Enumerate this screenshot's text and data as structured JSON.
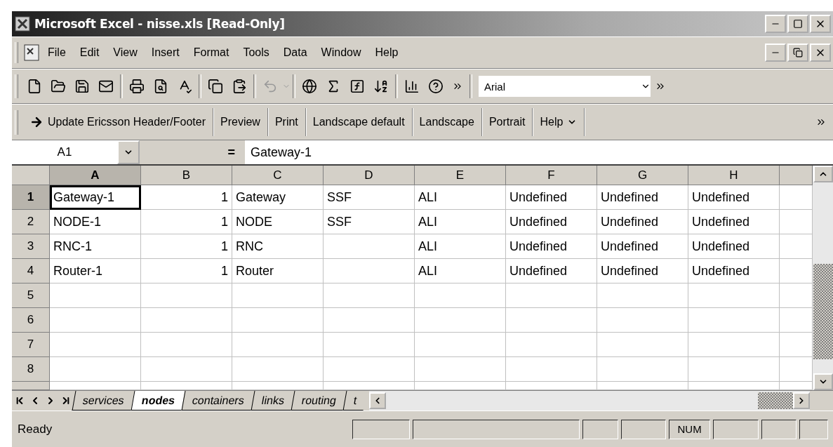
{
  "window": {
    "title": "Microsoft Excel - nisse.xls  [Read-Only]"
  },
  "menu": [
    "File",
    "Edit",
    "View",
    "Insert",
    "Format",
    "Tools",
    "Data",
    "Window",
    "Help"
  ],
  "font_box": {
    "value": "Arial"
  },
  "custom_toolbar": [
    {
      "label": "Update Ericsson Header/Footer",
      "kind": "arrow"
    },
    {
      "label": "Preview",
      "kind": "plain"
    },
    {
      "label": "Print",
      "kind": "plain"
    },
    {
      "label": "Landscape default",
      "kind": "plain"
    },
    {
      "label": "Landscape",
      "kind": "plain"
    },
    {
      "label": "Portrait",
      "kind": "plain"
    },
    {
      "label": "Help",
      "kind": "dropdown"
    }
  ],
  "formula_bar": {
    "name_box": "A1",
    "equals": "=",
    "value": "Gateway-1"
  },
  "table": {
    "columns": [
      {
        "label": "A",
        "selected": true
      },
      {
        "label": "B",
        "selected": false
      },
      {
        "label": "C",
        "selected": false
      },
      {
        "label": "D",
        "selected": false
      },
      {
        "label": "E",
        "selected": false
      },
      {
        "label": "F",
        "selected": false
      },
      {
        "label": "G",
        "selected": false
      },
      {
        "label": "H",
        "selected": false
      }
    ],
    "rows": [
      {
        "label": "1",
        "selected": true,
        "cells": [
          "Gateway-1",
          "1",
          "Gateway",
          "SSF",
          "ALI",
          "Undefined",
          "Undefined",
          "Undefined"
        ]
      },
      {
        "label": "2",
        "selected": false,
        "cells": [
          "NODE-1",
          "1",
          "NODE",
          "SSF",
          "ALI",
          "Undefined",
          "Undefined",
          "Undefined"
        ]
      },
      {
        "label": "3",
        "selected": false,
        "cells": [
          "RNC-1",
          "1",
          "RNC",
          "",
          "ALI",
          "Undefined",
          "Undefined",
          "Undefined"
        ]
      },
      {
        "label": "4",
        "selected": false,
        "cells": [
          "Router-1",
          "1",
          "Router",
          "",
          "ALI",
          "Undefined",
          "Undefined",
          "Undefined"
        ]
      },
      {
        "label": "5",
        "selected": false,
        "cells": []
      },
      {
        "label": "6",
        "selected": false,
        "cells": []
      },
      {
        "label": "7",
        "selected": false,
        "cells": []
      },
      {
        "label": "8",
        "selected": false,
        "cells": []
      }
    ]
  },
  "sheet_tabs": [
    {
      "label": "services",
      "selected": false
    },
    {
      "label": "nodes",
      "selected": true
    },
    {
      "label": "containers",
      "selected": false
    },
    {
      "label": "links",
      "selected": false
    },
    {
      "label": "routing",
      "selected": false
    },
    {
      "label": "t",
      "selected": false
    }
  ],
  "status_bar": {
    "text": "Ready",
    "indicators": [
      "NUM"
    ]
  }
}
